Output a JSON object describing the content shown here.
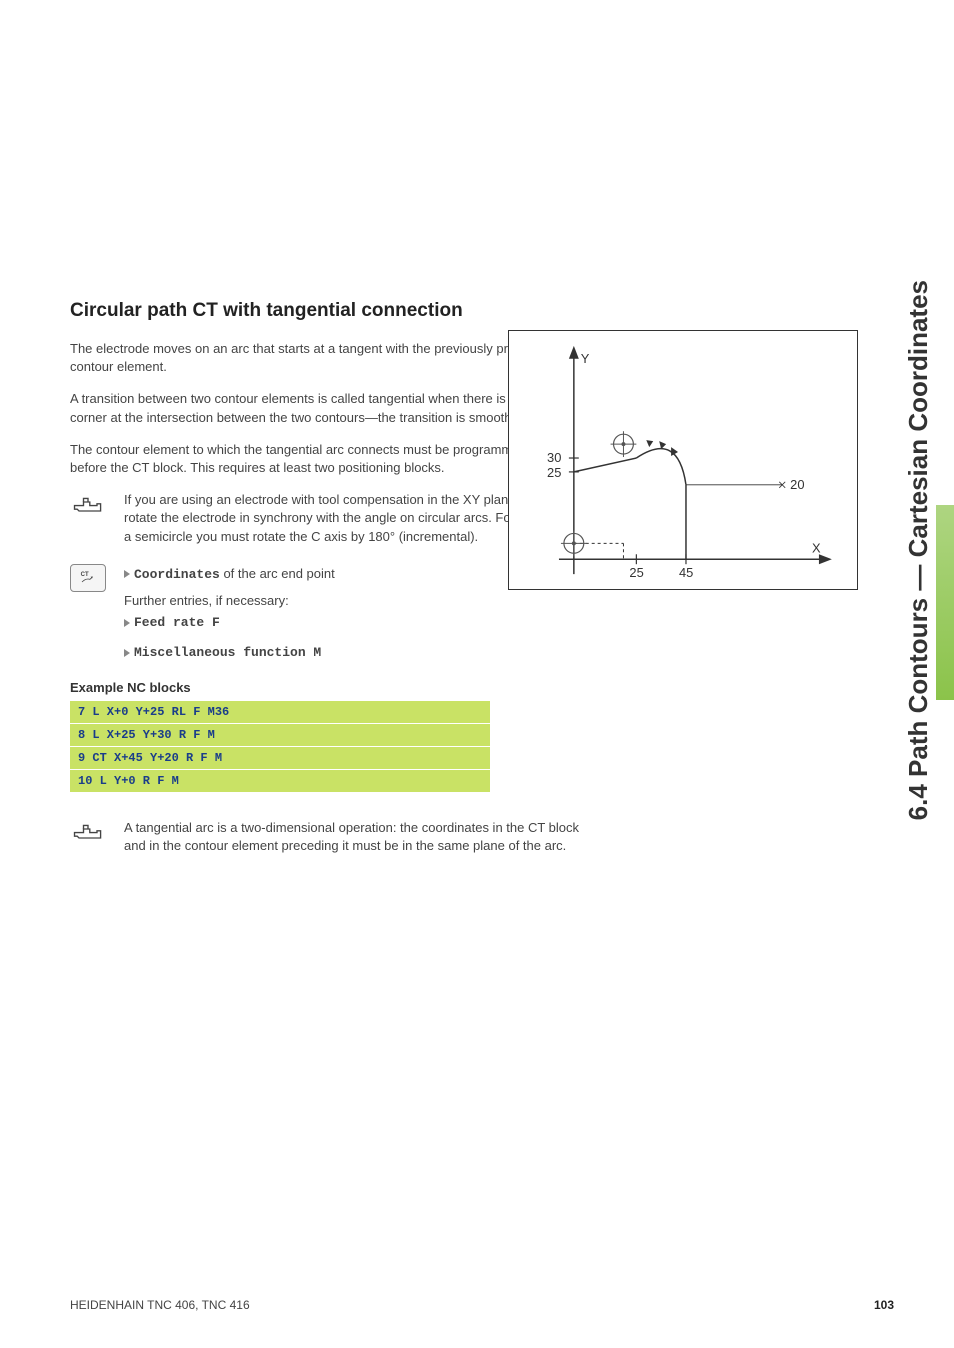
{
  "section_title": "6.4 Path Contours — Cartesian Coordinates",
  "heading": "Circular path CT with tangential connection",
  "paragraphs": {
    "p1": "The electrode moves on an arc that starts at a tangent with the previously programmed contour element.",
    "p2": "A transition between two contour elements is called tangential when there is no kink or corner at the intersection between the two contours—the transition is smooth.",
    "p3": "The contour element to which the tangential arc connects must be programmed immediately before the CT block. This requires at least two positioning blocks."
  },
  "note1": "If you are using an electrode with tool compensation in the XY plane, you must rotate the electrode in synchrony with the angle on circular arcs. For example, for a semicircle you must rotate the C axis by 180° (incremental).",
  "entry": {
    "coord_label": "Coordinates",
    "coord_rest": " of the arc end point",
    "further": "Further entries, if necessary:",
    "feed": "Feed rate F",
    "misc": "Miscellaneous function M"
  },
  "example_heading": "Example NC blocks",
  "code_lines": {
    "l1": "7 L X+0 Y+25 RL F M36",
    "l2": "8 L X+25 Y+30 R F M",
    "l3": "9 CT X+45 Y+20 R F M",
    "l4": "10 L Y+0 R F M"
  },
  "note2": "A tangential arc is a two-dimensional operation: the coordinates in the CT block and in the contour element preceding it must be in the same plane of the arc.",
  "figure": {
    "y_label": "Y",
    "x_label": "X",
    "tick_25x": "25",
    "tick_45x": "45",
    "tick_30y": "30",
    "tick_25y": "25",
    "tick_20": "20"
  },
  "footer_left": "HEIDENHAIN TNC 406, TNC 416",
  "page_number": "103",
  "key_label": "CT"
}
